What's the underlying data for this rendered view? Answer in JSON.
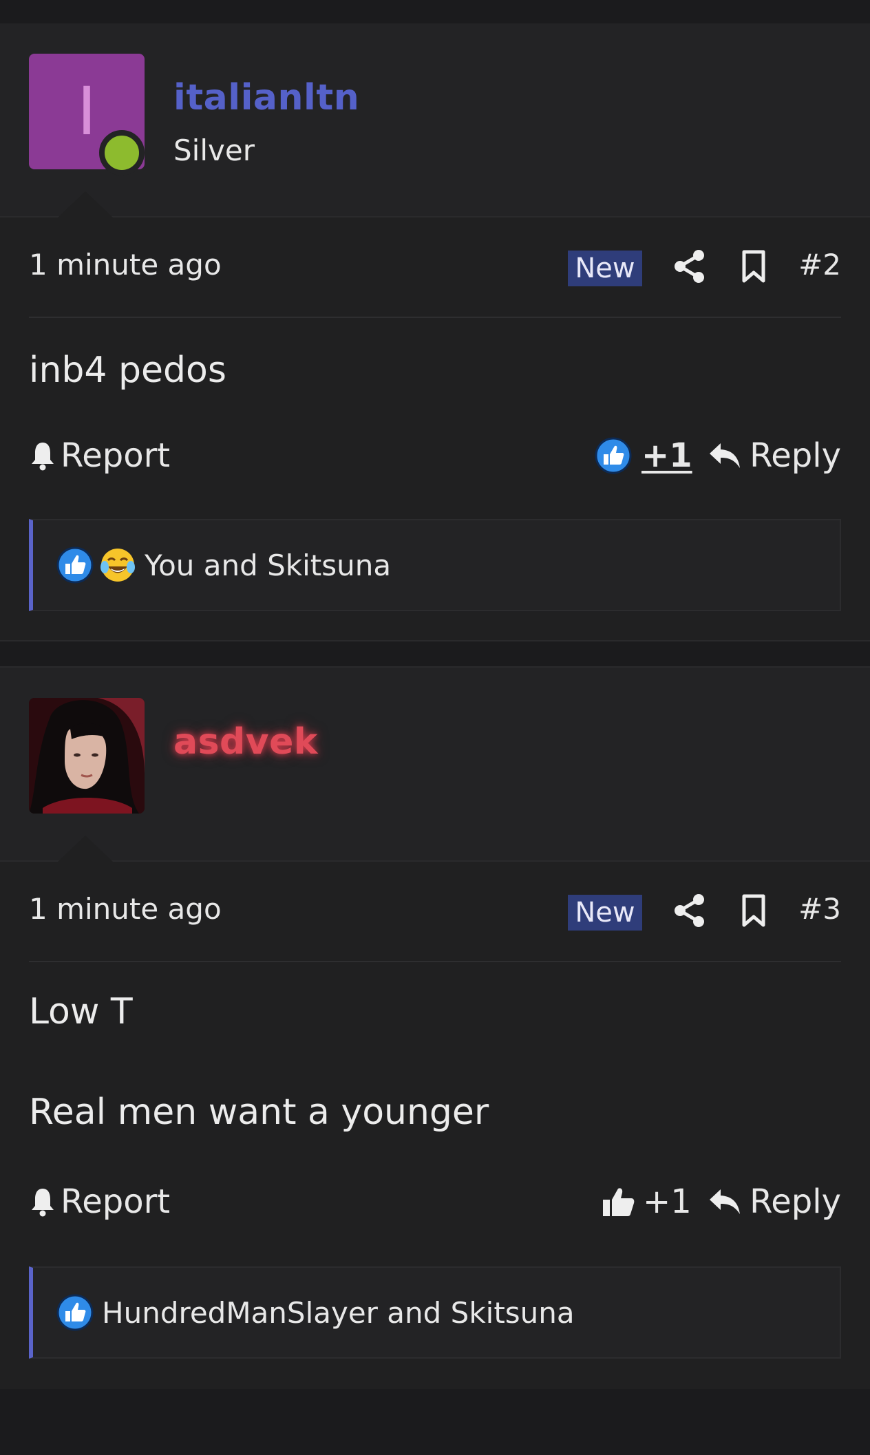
{
  "posts": [
    {
      "avatar_letter": "I",
      "username": "italianltn",
      "user_title": "Silver",
      "time": "1 minute ago",
      "badge": "New",
      "post_number": "#2",
      "message_lines": [
        "inb4 pedos"
      ],
      "report_label": "Report",
      "reaction_count": "+1",
      "reply_label": "Reply",
      "reactions_text": "You and Skitsuna"
    },
    {
      "username": "asdvek",
      "time": "1 minute ago",
      "badge": "New",
      "post_number": "#3",
      "message_lines": [
        "Low T",
        "Real men want a younger"
      ],
      "report_label": "Report",
      "reaction_count": "+1",
      "reply_label": "Reply",
      "reactions_text": "HundredManSlayer and Skitsuna"
    }
  ],
  "icons": {
    "share": "share-icon",
    "bookmark": "bookmark-icon",
    "report": "bell-icon",
    "reply": "reply-arrow-icon",
    "like": "thumbs-up-icon",
    "laugh": "laughing-tears-emoji-icon",
    "online": "online-status-dot"
  },
  "colors": {
    "accent_blue": "#5561c9",
    "username_red": "#e04a58",
    "new_badge": "#2f3d7a",
    "avatar_purple": "#8b3a95",
    "online_green": "#8dbb2e",
    "like_blue": "#2f8be8"
  }
}
